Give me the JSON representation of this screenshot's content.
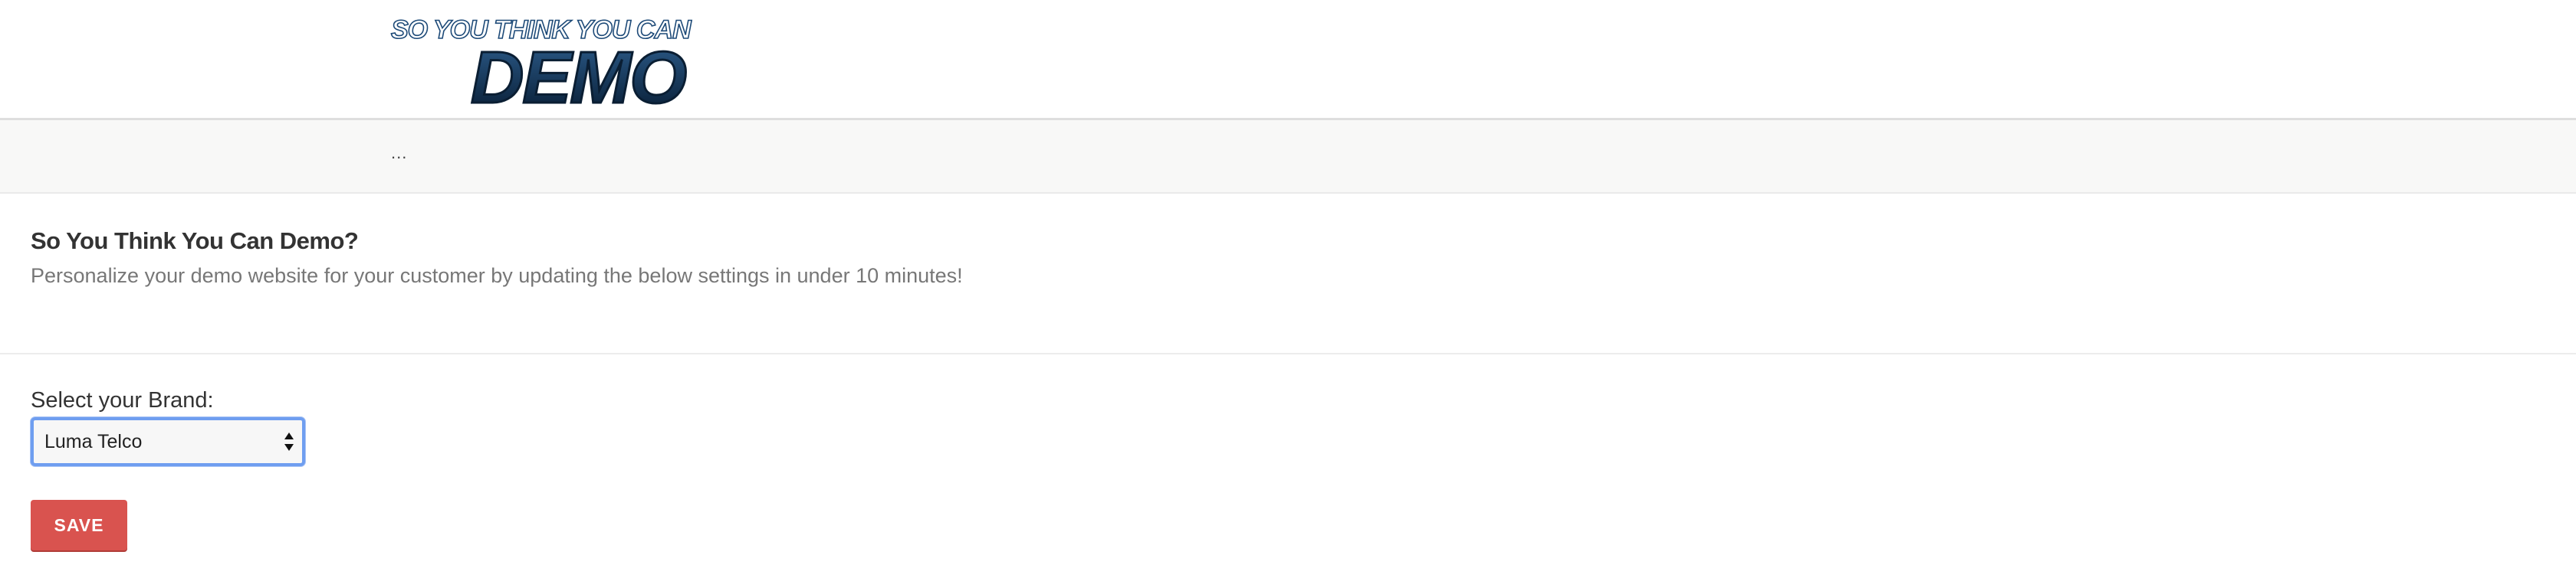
{
  "header": {
    "logo_line1": "SO YOU THINK YOU CAN",
    "logo_line2": "DEMO"
  },
  "breadcrumb": "...",
  "intro": {
    "title": "So You Think You Can Demo?",
    "subtitle": "Personalize your demo website for your customer by updating the below settings in under 10 minutes!"
  },
  "form": {
    "brand_label": "Select your Brand:",
    "brand_selected": "Luma Telco",
    "save_label": "SAVE"
  },
  "colors": {
    "save_button": "#d9534f",
    "select_focus": "#6f9ef0",
    "logo_fill": "#0e2a47"
  },
  "icons": {
    "select_arrows": "select-arrows-icon"
  }
}
